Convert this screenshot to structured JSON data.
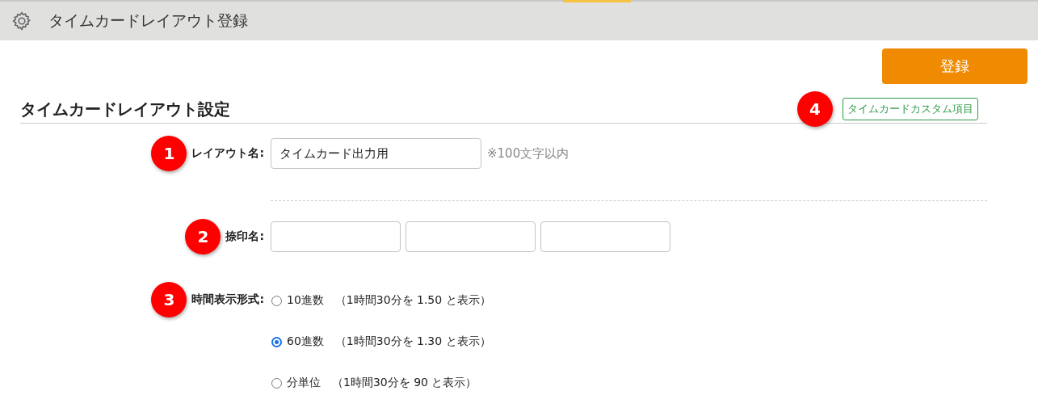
{
  "header": {
    "title": "タイムカードレイアウト登録"
  },
  "register_button": "登録",
  "section": {
    "title": "タイムカードレイアウト設定",
    "badge": "4",
    "custom_items_button": "タイムカードカスタム項目"
  },
  "rows": [
    {
      "kind": "text",
      "badge": "1",
      "label": "レイアウト名:",
      "value": "タイムカード出力用",
      "note": "※100文字以内"
    },
    {
      "kind": "divider"
    },
    {
      "kind": "stamps",
      "badge": "2",
      "label": "捺印名:",
      "fields": [
        {
          "kind": "input"
        },
        {
          "kind": "input"
        },
        {
          "kind": "input"
        }
      ]
    },
    {
      "kind": "radios",
      "badge": "3",
      "label": "時間表示形式:",
      "options": [
        {
          "label": "10進数",
          "note": "（1時間30分を 1.50 と表示）",
          "selected": false
        },
        {
          "label": "60進数",
          "note": "（1時間30分を 1.30 と表示）",
          "selected": true
        },
        {
          "label": "分単位",
          "note": "（1時間30分を 90 と表示）",
          "selected": false
        }
      ]
    }
  ]
}
